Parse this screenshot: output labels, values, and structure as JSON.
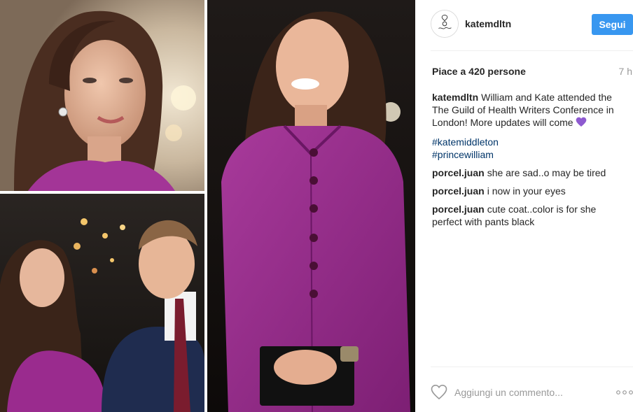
{
  "post": {
    "username": "katemdltn",
    "follow_label": "Segui",
    "likes_text": "Piace a 420 persone",
    "time_ago": "7 h",
    "caption": {
      "author": "katemdltn",
      "text": "William and Kate attended the The Guild of Health Writers Conference in London! More updates will come",
      "emoji": "purple-heart-icon",
      "hashtags": [
        "#katemiddleton",
        "#princewilliam"
      ]
    },
    "comments": [
      {
        "author": "porcel.juan",
        "text": "she are sad..o may be tired"
      },
      {
        "author": "porcel.juan",
        "text": "i now in your eyes"
      },
      {
        "author": "porcel.juan",
        "text": "cute coat..color is for she perfect with pants black"
      }
    ],
    "add_comment_placeholder": "Aggiungi un commento...",
    "icons": {
      "like": "heart-outline-icon",
      "more": "more-options-icon"
    },
    "colors": {
      "follow_button": "#3897f0",
      "hashtag": "#003569",
      "coat": "#9a2b8e"
    }
  }
}
